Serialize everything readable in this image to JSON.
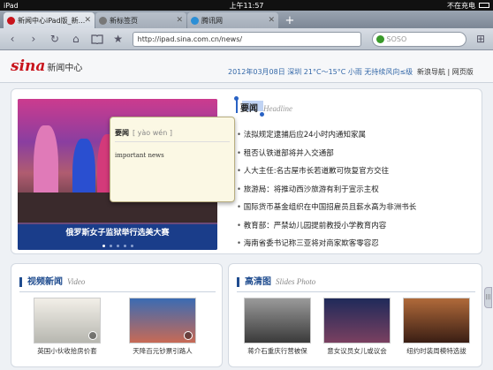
{
  "status": {
    "device": "iPad",
    "wifi": "WiFi",
    "time": "上午11:57",
    "charging": "不在充电"
  },
  "tabs": [
    {
      "label": "新闻中心iPad版_新...",
      "active": true,
      "favicon_color": "#c8141c"
    },
    {
      "label": "新标签页",
      "active": false,
      "favicon_color": "#777777"
    },
    {
      "label": "腾讯网",
      "active": false,
      "favicon_color": "#2c8fd6"
    }
  ],
  "toolbar": {
    "back": "‹",
    "forward": "›",
    "reload": "↻",
    "home": "⌂",
    "bookmarks": "📖",
    "star": "★",
    "url": "http://ipad.sina.com.cn/news/",
    "search_placeholder": "SOSO",
    "search_engine_color": "#3a9a2a"
  },
  "site": {
    "logo": "sina",
    "logo_sub": "新闻中心",
    "dateline": "2012年03月08日 深圳 21°C～15°C 小雨 无持续风向≤级",
    "nav": "新浪导航 | 网页版"
  },
  "slider": {
    "caption": "俄罗斯女子监狱举行选美大赛",
    "dots": 5,
    "active_dot": 0
  },
  "popup": {
    "word": "要闻",
    "pinyin": "[ yào wén ]",
    "definition": "important news"
  },
  "headlines": {
    "title": "要闻",
    "title_en": "Headline",
    "items": [
      "法拟规定逮捕后应24小时内通知家属",
      "租否认铁道部将并入交通部",
      "人大主任:名古屋市长若道歉可恢复官方交往",
      "旅游局：将推动西沙旅游有利于宣示主权",
      "国际货币基金组织在中国招雇员且薪水高为非洲书长",
      "教育部：严禁幼儿园提前教授小学教育内容",
      "海南省委书记称三亚将对商家欺客零容忍"
    ]
  },
  "video": {
    "title": "视频新闻",
    "title_en": "Video",
    "items": [
      {
        "caption": "英国小伙收拾房价套"
      },
      {
        "caption": "天降百元钞票引路人"
      }
    ]
  },
  "slides": {
    "title": "高清图",
    "title_en": "Slides Photo",
    "items": [
      {
        "caption": "蒋介石重庆行营被保"
      },
      {
        "caption": "意女议员女儿或议会"
      },
      {
        "caption": "纽约时装周模特选拔"
      }
    ]
  },
  "colors": {
    "brand": "#c8141c",
    "accent": "#1f4c8f",
    "caption_bg": "#1a3d8a"
  }
}
